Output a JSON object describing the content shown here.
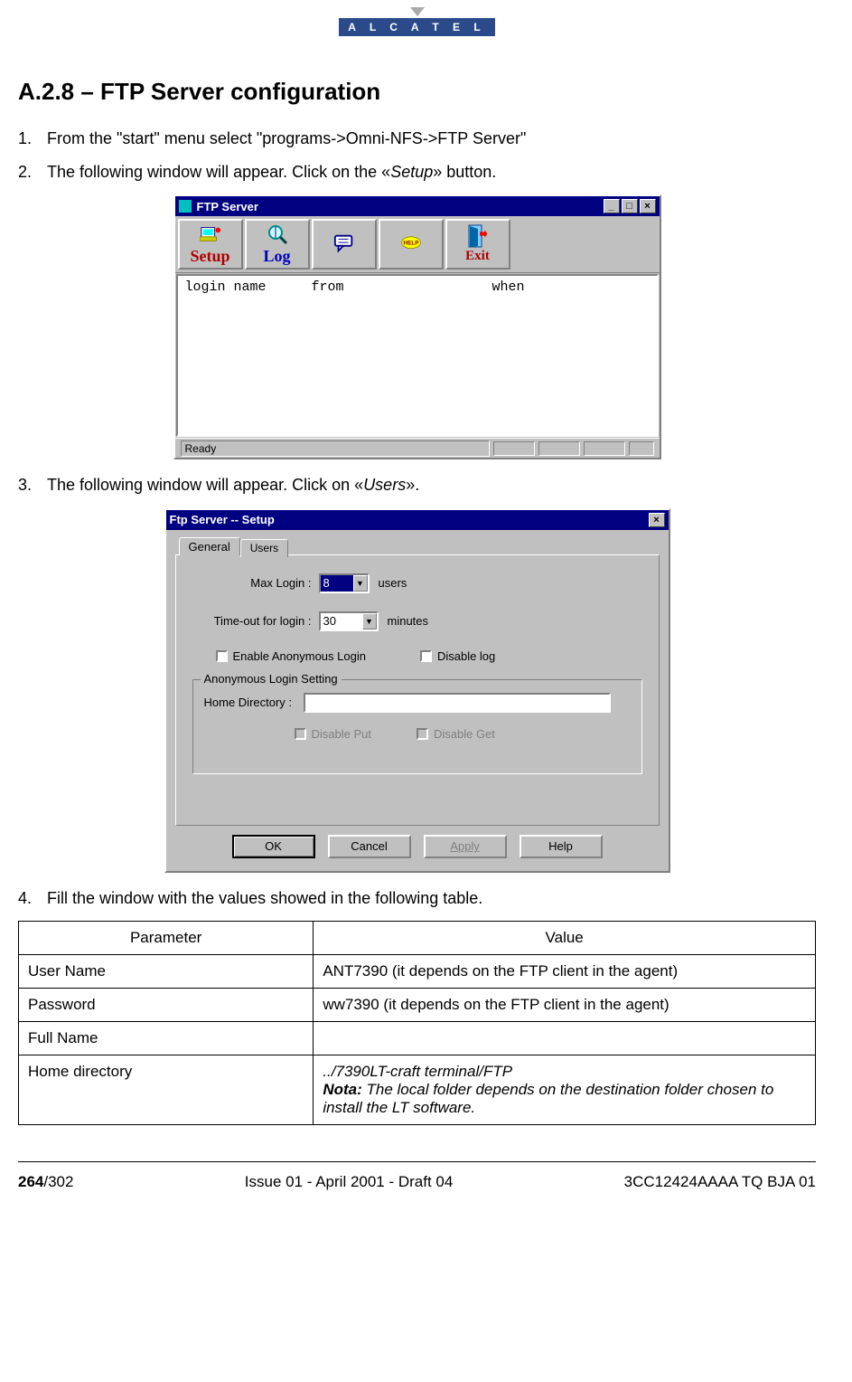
{
  "logo": "A L C A T E L",
  "heading": "A.2.8 – FTP Server configuration",
  "steps": {
    "s1": {
      "num": "1.",
      "text": "From the \"start\" menu select \"programs->Omni-NFS->FTP Server\""
    },
    "s2": {
      "num": "2.",
      "pre": "The following window will appear. Click on the «",
      "em": "Setup",
      "post": "» button."
    },
    "s3": {
      "num": "3.",
      "pre": "The following window will appear. Click on «",
      "em": "Users",
      "post": "»."
    },
    "s4": {
      "num": "4.",
      "text": "Fill the window with the values showed in the following table."
    }
  },
  "win1": {
    "title": "FTP Server",
    "toolbar": {
      "setup": "Setup",
      "log": "Log",
      "exit": "Exit"
    },
    "cols": {
      "login": "login name",
      "from": "from",
      "when": "when"
    },
    "status": "Ready"
  },
  "win2": {
    "title": "Ftp Server -- Setup",
    "tabs": {
      "general": "General",
      "users": "Users"
    },
    "maxlogin_label": "Max Login  :",
    "maxlogin_value": "8",
    "maxlogin_unit": "users",
    "timeout_label": "Time-out for login :",
    "timeout_value": "30",
    "timeout_unit": "minutes",
    "chk_anon": "Enable Anonymous Login",
    "chk_dlog": "Disable log",
    "group_legend": "Anonymous Login Setting",
    "home_label": "Home Directory :",
    "chk_dput": "Disable Put",
    "chk_dget": "Disable Get",
    "btn_ok": "OK",
    "btn_cancel": "Cancel",
    "btn_apply": "Apply",
    "btn_help": "Help"
  },
  "table": {
    "h1": "Parameter",
    "h2": "Value",
    "r1p": "User Name",
    "r1v": "ANT7390 (it depends on the FTP client in the agent)",
    "r2p": "Password",
    "r2v": "ww7390 (it depends on the FTP client in the agent)",
    "r3p": "Full Name",
    "r3v": "",
    "r4p": "Home directory",
    "r4v_path": "../7390LT-craft terminal/FTP",
    "r4v_nota_label": "Nota:",
    "r4v_nota_text": " The local folder depends on the destination folder chosen to install the LT software."
  },
  "footer": {
    "page_bold": "264",
    "page_total": "/302",
    "center": "Issue 01 - April 2001 - Draft 04",
    "right": "3CC12424AAAA TQ BJA 01"
  }
}
